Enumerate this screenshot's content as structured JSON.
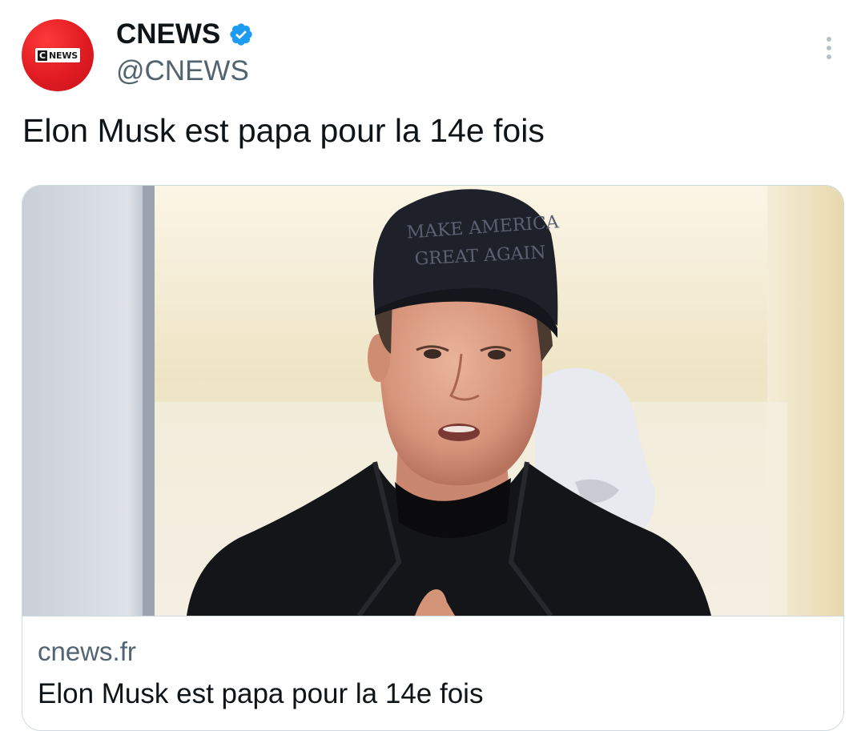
{
  "account": {
    "display_name": "CNEWS",
    "handle": "@CNEWS",
    "verified": true,
    "avatar_logo_letter": "C",
    "avatar_logo_text": "NEWS",
    "brand_color": "#e01b22",
    "verified_color": "#1d9bf0"
  },
  "tweet": {
    "text": "Elon Musk est papa pour la 14e fois"
  },
  "card": {
    "domain": "cnews.fr",
    "title": "Elon Musk est papa pour la 14e fois",
    "image": {
      "cap_line1": "MAKE AMERICA",
      "cap_line2": "GREAT AGAIN"
    }
  },
  "icons": {
    "more": "more-options-icon",
    "verified": "verified-badge-icon"
  }
}
